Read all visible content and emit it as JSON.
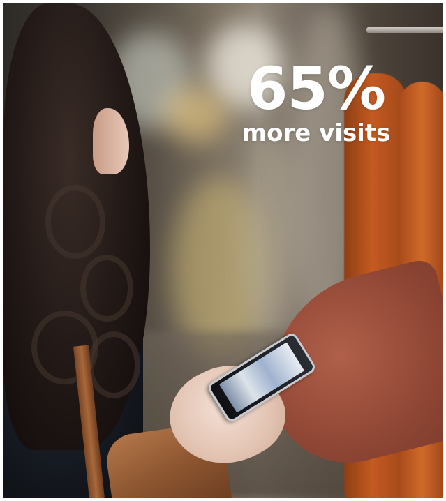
{
  "stat": {
    "value": "65%",
    "label": "more visits"
  },
  "colors": {
    "text": "#ffffff",
    "coat_accent": "#c45a21"
  },
  "icons": [
    "smartphone-icon"
  ]
}
